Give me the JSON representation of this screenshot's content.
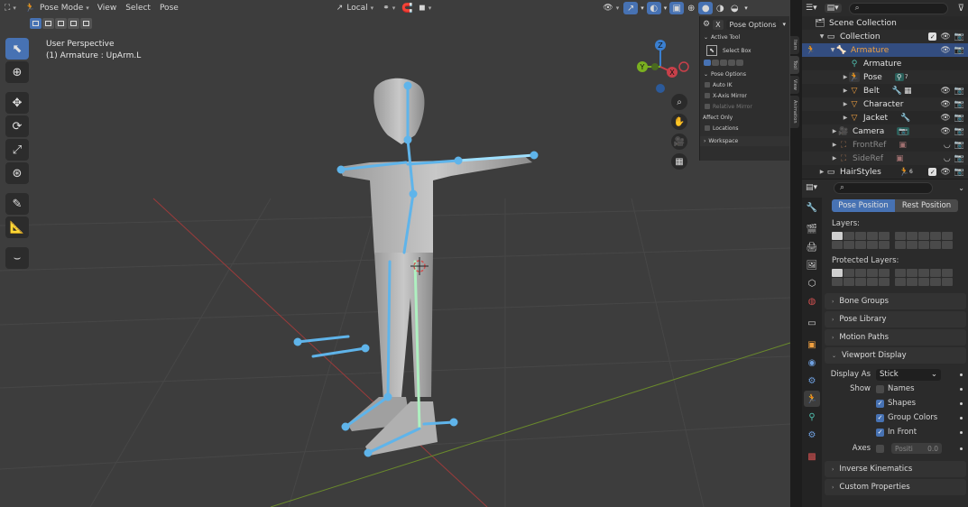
{
  "header": {
    "mode": "Pose Mode",
    "menus": [
      "View",
      "Select",
      "Pose"
    ],
    "transform_orientation": "Local"
  },
  "viewport": {
    "perspective": "User Perspective",
    "active_object": "(1) Armature : UpArm.L"
  },
  "gizmo": {
    "z": "Z",
    "y": "Y",
    "x": "X"
  },
  "npanel": {
    "close": "X",
    "title": "Pose Options",
    "active_tool": "Active Tool",
    "select_box": "Select Box",
    "pose_options": "Pose Options",
    "auto_ik": "Auto IK",
    "x_axis_mirror": "X-Axis Mirror",
    "relative_mirror": "Relative Mirror",
    "affect_only": "Affect Only",
    "locations": "Locations",
    "workspace": "Workspace",
    "tabs": [
      "Item",
      "Tool",
      "View",
      "Animation"
    ]
  },
  "outliner": {
    "rows": [
      {
        "label": "Scene Collection"
      },
      {
        "label": "Collection"
      },
      {
        "label": "Armature"
      },
      {
        "label": "Armature"
      },
      {
        "label": "Pose",
        "badge": "7"
      },
      {
        "label": "Belt"
      },
      {
        "label": "Character"
      },
      {
        "label": "Jacket"
      },
      {
        "label": "Camera"
      },
      {
        "label": "FrontRef"
      },
      {
        "label": "SideRef"
      },
      {
        "label": "HairStyles",
        "badge": "6"
      }
    ]
  },
  "properties": {
    "pose_position": "Pose Position",
    "rest_position": "Rest Position",
    "layers": "Layers:",
    "protected_layers": "Protected Layers:",
    "bone_groups": "Bone Groups",
    "pose_library": "Pose Library",
    "motion_paths": "Motion Paths",
    "viewport_display": "Viewport Display",
    "display_as_label": "Display As",
    "display_as_value": "Stick",
    "show_label": "Show",
    "names": "Names",
    "shapes": "Shapes",
    "group_colors": "Group Colors",
    "in_front": "In Front",
    "axes_label": "Axes",
    "axes_field": "Positi",
    "axes_value": "0.0",
    "inverse_kinematics": "Inverse Kinematics",
    "custom_properties": "Custom Properties"
  }
}
